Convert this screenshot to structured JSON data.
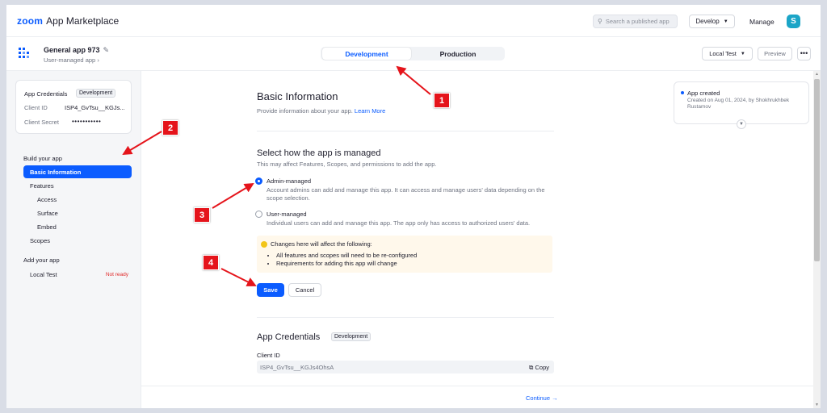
{
  "topbar": {
    "brand_zoom": "zoom",
    "brand_market": "App Marketplace",
    "search_placeholder": "Search a published app",
    "develop_label": "Develop",
    "manage_label": "Manage",
    "avatar_letter": "S"
  },
  "app_header": {
    "app_name": "General app 973",
    "app_type": "User-managed app",
    "tabs": [
      {
        "label": "Development",
        "active": true
      },
      {
        "label": "Production",
        "active": false
      }
    ],
    "local_test_label": "Local Test",
    "preview_label": "Preview",
    "more_label": "•••"
  },
  "sidebar": {
    "credentials": {
      "title": "App Credentials",
      "badge": "Development",
      "client_id_label": "Client ID",
      "client_id_value": "ISP4_GvTsu__KGJs...",
      "client_secret_label": "Client Secret",
      "client_secret_value": "•••••••••••"
    },
    "build_header": "Build your app",
    "build_items": [
      {
        "label": "Basic Information",
        "active": true
      },
      {
        "label": "Features"
      },
      {
        "label": "Access"
      },
      {
        "label": "Surface"
      },
      {
        "label": "Embed"
      },
      {
        "label": "Scopes"
      }
    ],
    "add_header": "Add your app",
    "local_test": {
      "label": "Local Test",
      "status": "Not ready"
    }
  },
  "main": {
    "title": "Basic Information",
    "subtitle": "Provide information about your app.",
    "learn_more": "Learn More",
    "manage_title": "Select how the app is managed",
    "manage_subtitle": "This may affect Features, Scopes, and permissions to add the app.",
    "options": [
      {
        "label": "Admin-managed",
        "selected": true,
        "description": "Account admins can add and manage this app. It can access and manage users' data depending on the scope selection."
      },
      {
        "label": "User-managed",
        "selected": false,
        "description": "Individual users can add and manage this app. The app only has access to authorized users' data."
      }
    ],
    "warning": {
      "title": "Changes here will affect the following:",
      "items": [
        "All features and scopes will need to be re-configured",
        "Requirements for adding this app will change"
      ]
    },
    "save_label": "Save",
    "cancel_label": "Cancel",
    "credentials_title": "App Credentials",
    "credentials_badge": "Development",
    "client_id_label": "Client ID",
    "client_id_value": "ISP4_GvTsu__KGJs4OhsA",
    "copy_label": "Copy",
    "continue_label": "Continue"
  },
  "activity": {
    "title": "App created",
    "detail": "Created on Aug 01, 2024, by Shokhrukhbek Rustamov"
  },
  "annotations": [
    {
      "number": "1"
    },
    {
      "number": "2"
    },
    {
      "number": "3"
    },
    {
      "number": "4"
    }
  ],
  "colors": {
    "accent": "#0b5cff",
    "annotation": "#e5141b",
    "warning_bg": "#fff8eb",
    "danger": "#e02828"
  }
}
